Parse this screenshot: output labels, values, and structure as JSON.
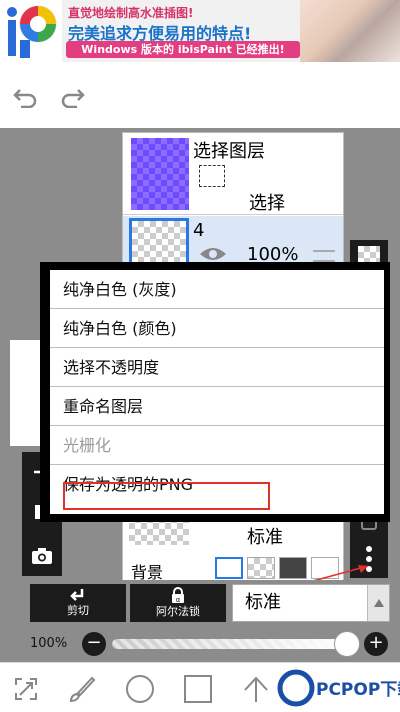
{
  "ad": {
    "line1": "直觉地绘制高水准插图!",
    "line2": "完美追求方便易用的特点!",
    "line3": "Windows 版本的 ibisPaint 已经推出!"
  },
  "toolbar": {
    "undo_icon": "undo-icon",
    "redo_icon": "redo-icon"
  },
  "layers": {
    "selection": {
      "name": "选择图层",
      "mode": "选择"
    },
    "layer4": {
      "number": "4",
      "opacity": "100%"
    },
    "partial_mode": "标准",
    "background_label": "背景"
  },
  "menu": {
    "items": [
      {
        "label": "纯净白色 (灰度)",
        "enabled": true
      },
      {
        "label": "纯净白色 (颜色)",
        "enabled": true
      },
      {
        "label": "选择不透明度",
        "enabled": true
      },
      {
        "label": "重命名图层",
        "enabled": true
      },
      {
        "label": "光栅化",
        "enabled": false
      },
      {
        "label": "保存为透明的PNG",
        "enabled": true
      }
    ]
  },
  "actions": {
    "clip_label": "剪切",
    "alpha_lock_label": "阿尔法锁",
    "blend_mode": "标准"
  },
  "opacity": {
    "label": "100%",
    "value": 1.0
  },
  "watermark": {
    "text": "PCPOP下载"
  },
  "colors": {
    "highlight": "#e0312b",
    "selection_thumb": "#6b4cff",
    "active_layer_bg": "#dbe6f7",
    "active_layer_border": "#2b78e4"
  }
}
